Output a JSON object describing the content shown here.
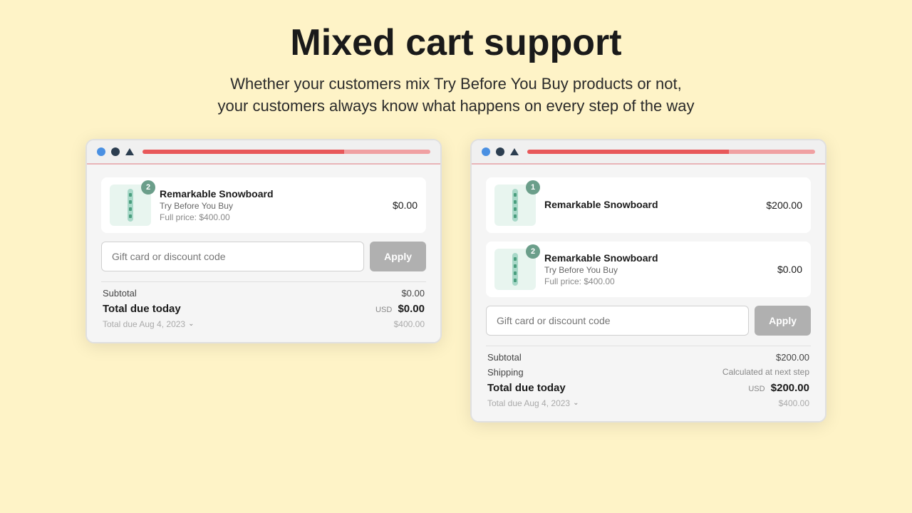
{
  "hero": {
    "title": "Mixed cart support",
    "subtitle_line1": "Whether your customers mix Try Before You Buy products or not,",
    "subtitle_line2": "your customers always know what happens on every step of the way"
  },
  "left_card": {
    "item": {
      "badge": "2",
      "name": "Remarkable Snowboard",
      "tag": "Try Before You Buy",
      "full_price_label": "Full price: $400.00",
      "price": "$0.00"
    },
    "discount": {
      "placeholder": "Gift card or discount code",
      "apply_label": "Apply"
    },
    "summary": {
      "subtotal_label": "Subtotal",
      "subtotal_value": "$0.00",
      "total_label": "Total due today",
      "total_usd": "USD",
      "total_value": "$0.00",
      "due_date_label": "Total due Aug 4, 2023",
      "due_date_value": "$400.00"
    }
  },
  "right_card": {
    "item1": {
      "badge": "1",
      "name": "Remarkable Snowboard",
      "price": "$200.00"
    },
    "item2": {
      "badge": "2",
      "name": "Remarkable Snowboard",
      "tag": "Try Before You Buy",
      "full_price_label": "Full price: $400.00",
      "price": "$0.00"
    },
    "discount": {
      "placeholder": "Gift card or discount code",
      "apply_label": "Apply"
    },
    "summary": {
      "subtotal_label": "Subtotal",
      "subtotal_value": "$200.00",
      "shipping_label": "Shipping",
      "shipping_value": "Calculated at next step",
      "total_label": "Total due today",
      "total_usd": "USD",
      "total_value": "$200.00",
      "due_date_label": "Total due Aug 4, 2023",
      "due_date_value": "$400.00"
    }
  },
  "icons": {
    "chevron": "›"
  }
}
